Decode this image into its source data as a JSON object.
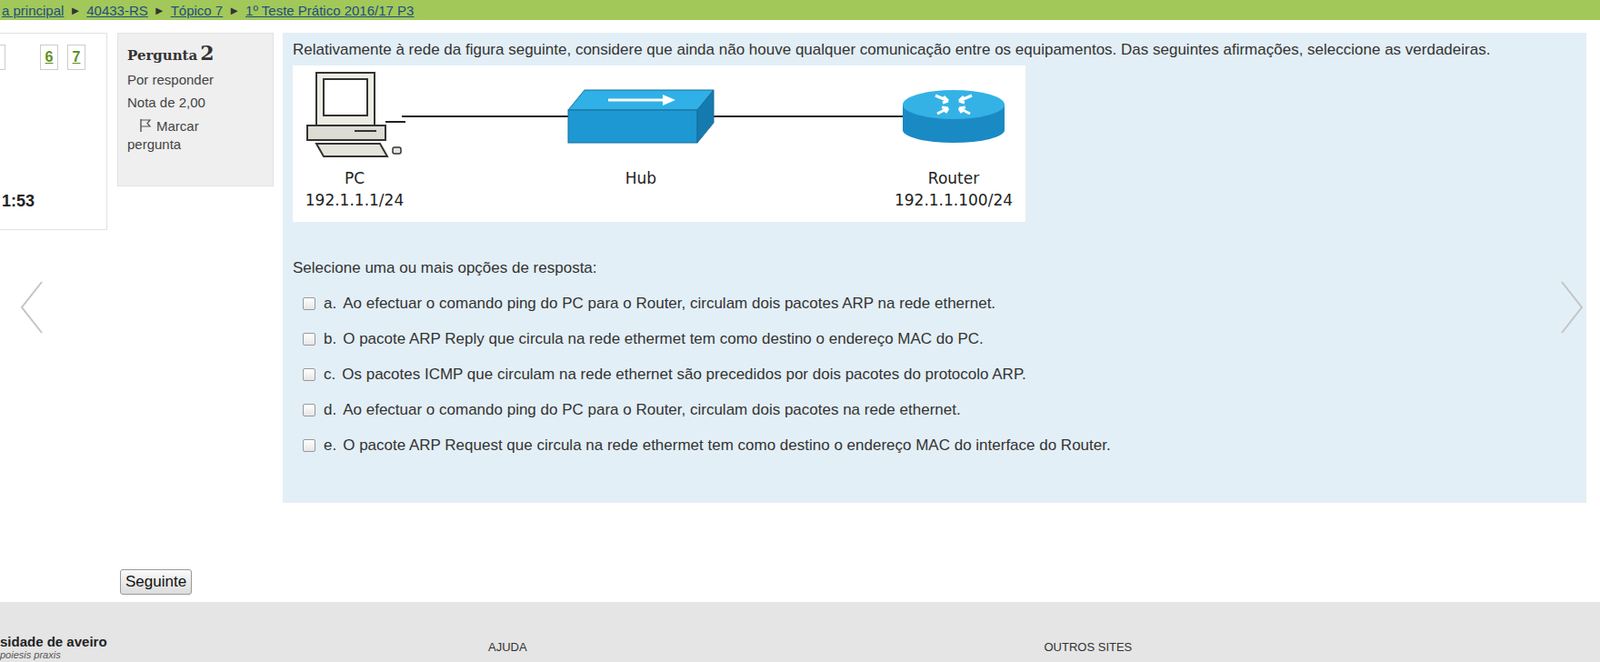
{
  "breadcrumb": {
    "items": [
      "a principal",
      "40433-RS",
      "Tópico 7",
      "1º Teste Prático 2016/17 P3"
    ],
    "separator": "►"
  },
  "nav": {
    "pages": [
      {
        "label": "6"
      },
      {
        "label": "7"
      }
    ],
    "timer": "1:53"
  },
  "question": {
    "title": "Pergunta",
    "number": "2",
    "status": "Por responder",
    "grade": "Nota de 2,00",
    "flag": "Marcar pergunta",
    "flagged": false
  },
  "prompt": "Relativamente à rede da figura seguinte, considere que ainda não houve qualquer comunicação entre os equipamentos. Das seguintes afirmações, seleccione as verdadeiras.",
  "diagram": {
    "nodes": [
      {
        "kind": "pc",
        "label": "PC",
        "address": "192.1.1.1/24"
      },
      {
        "kind": "hub",
        "label": "Hub"
      },
      {
        "kind": "router",
        "label": "Router",
        "address": "192.1.1.100/24"
      }
    ]
  },
  "instruction": "Selecione uma ou mais opções de resposta:",
  "options": [
    {
      "letter": "a.",
      "text": "Ao efectuar o comando ping do PC para o Router, circulam dois pacotes ARP na rede ethernet.",
      "checked": false
    },
    {
      "letter": "b.",
      "text": "O pacote ARP Reply que circula na rede ethermet tem como destino o endereço MAC do PC.",
      "checked": false
    },
    {
      "letter": "c.",
      "text": "Os pacotes ICMP que circulam na rede ethernet são precedidos por dois pacotes do protocolo ARP.",
      "checked": false
    },
    {
      "letter": "d.",
      "text": "Ao efectuar o comando ping do PC para o Router, circulam dois pacotes na rede ethernet.",
      "checked": false
    },
    {
      "letter": "e.",
      "text": "O pacote ARP Request que circula na rede ethermet tem como destino o endereço MAC do interface do Router.",
      "checked": false
    }
  ],
  "next_button": "Seguinte",
  "footer": {
    "logo": "sidade de aveiro",
    "motto": "poiesis praxis",
    "columns": [
      "AJUDA",
      "OUTROS SITES"
    ]
  }
}
